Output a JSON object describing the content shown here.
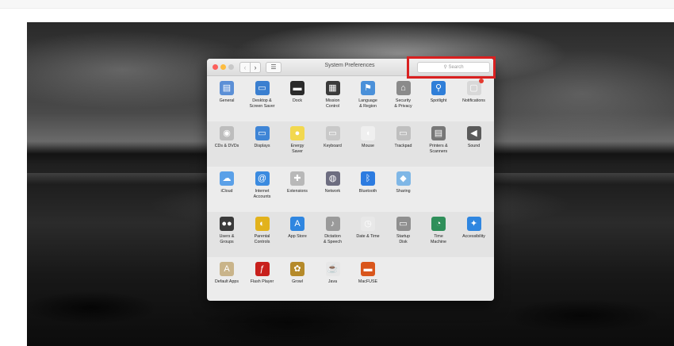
{
  "window": {
    "title": "System Preferences",
    "search_placeholder": "Search",
    "nav": {
      "back": "‹",
      "forward": "›",
      "grid": "☰"
    }
  },
  "rows": [
    [
      {
        "label": "General",
        "icon": "general-icon",
        "color": "#5b8fd6",
        "glyph": "▤"
      },
      {
        "label": "Desktop &\nScreen Saver",
        "icon": "desktop-icon",
        "color": "#3a7fd0",
        "glyph": "▭"
      },
      {
        "label": "Dock",
        "icon": "dock-icon",
        "color": "#2b2b2b",
        "glyph": "▬"
      },
      {
        "label": "Mission\nControl",
        "icon": "mission-control-icon",
        "color": "#3a3a3a",
        "glyph": "▦"
      },
      {
        "label": "Language\n& Region",
        "icon": "flag-icon",
        "color": "#4a90d9",
        "glyph": "⚑"
      },
      {
        "label": "Security\n& Privacy",
        "icon": "house-lock-icon",
        "color": "#8a8a8a",
        "glyph": "⌂"
      },
      {
        "label": "Spotlight",
        "icon": "spotlight-icon",
        "color": "#2f7ed8",
        "glyph": "⚲"
      },
      {
        "label": "Notifications",
        "icon": "notifications-icon",
        "color": "#d8d8d8",
        "glyph": "▢"
      }
    ],
    [
      {
        "label": "CDs & DVDs",
        "icon": "disc-icon",
        "color": "#bdbdbd",
        "glyph": "◉"
      },
      {
        "label": "Displays",
        "icon": "display-icon",
        "color": "#3f85d6",
        "glyph": "▭"
      },
      {
        "label": "Energy\nSaver",
        "icon": "lightbulb-icon",
        "color": "#f2d84f",
        "glyph": "●"
      },
      {
        "label": "Keyboard",
        "icon": "keyboard-icon",
        "color": "#c9c9c9",
        "glyph": "▭"
      },
      {
        "label": "Mouse",
        "icon": "mouse-icon",
        "color": "#efefef",
        "glyph": "◖"
      },
      {
        "label": "Trackpad",
        "icon": "trackpad-icon",
        "color": "#bfbfbf",
        "glyph": "▭"
      },
      {
        "label": "Printers &\nScanners",
        "icon": "printer-icon",
        "color": "#777777",
        "glyph": "▤"
      },
      {
        "label": "Sound",
        "icon": "speaker-icon",
        "color": "#5a5a5a",
        "glyph": "◀"
      }
    ],
    [
      {
        "label": "iCloud",
        "icon": "icloud-icon",
        "color": "#5aa0e8",
        "glyph": "☁"
      },
      {
        "label": "Internet\nAccounts",
        "icon": "at-icon",
        "color": "#3b8be0",
        "glyph": "@"
      },
      {
        "label": "Extensions",
        "icon": "puzzle-icon",
        "color": "#b8b8b8",
        "glyph": "✚"
      },
      {
        "label": "Network",
        "icon": "globe-icon",
        "color": "#6d6d80",
        "glyph": "◍"
      },
      {
        "label": "Bluetooth",
        "icon": "bluetooth-icon",
        "color": "#2c7be0",
        "glyph": "ᛒ"
      },
      {
        "label": "Sharing",
        "icon": "sharing-icon",
        "color": "#7fb7e6",
        "glyph": "◆"
      }
    ],
    [
      {
        "label": "Users &\nGroups",
        "icon": "users-icon",
        "color": "#3a3a3a",
        "glyph": "●●"
      },
      {
        "label": "Parental\nControls",
        "icon": "parental-controls-icon",
        "color": "#e2b21c",
        "glyph": "◐"
      },
      {
        "label": "App Store",
        "icon": "app-store-icon",
        "color": "#2f86e0",
        "glyph": "A"
      },
      {
        "label": "Dictation\n& Speech",
        "icon": "microphone-icon",
        "color": "#9a9a9a",
        "glyph": "♪"
      },
      {
        "label": "Date & Time",
        "icon": "clock-icon",
        "color": "#e8e8e8",
        "glyph": "◷"
      },
      {
        "label": "Startup\nDisk",
        "icon": "hard-drive-icon",
        "color": "#8f8f8f",
        "glyph": "▭"
      },
      {
        "label": "Time\nMachine",
        "icon": "time-machine-icon",
        "color": "#2f8f5a",
        "glyph": "◔"
      },
      {
        "label": "Accessibility",
        "icon": "accessibility-icon",
        "color": "#2f86e0",
        "glyph": "✦"
      }
    ],
    [
      {
        "label": "Default Apps",
        "icon": "default-apps-icon",
        "color": "#c9b48a",
        "glyph": "A"
      },
      {
        "label": "Flash Player",
        "icon": "flash-icon",
        "color": "#c8201c",
        "glyph": "ƒ"
      },
      {
        "label": "Growl",
        "icon": "growl-icon",
        "color": "#b58a2a",
        "glyph": "✿"
      },
      {
        "label": "Java",
        "icon": "java-icon",
        "color": "#e7e7e7",
        "glyph": "☕"
      },
      {
        "label": "MacFUSE",
        "icon": "macfuse-icon",
        "color": "#d9561c",
        "glyph": "▬"
      }
    ]
  ]
}
